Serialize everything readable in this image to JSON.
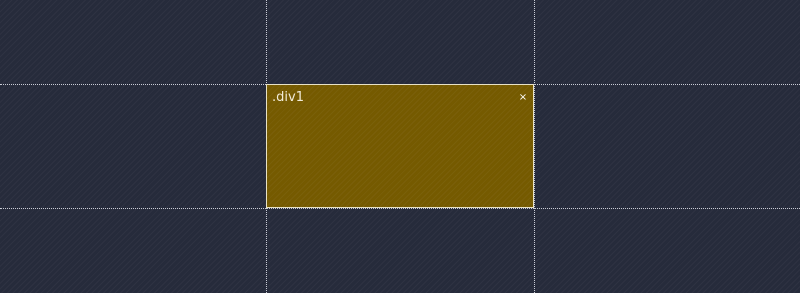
{
  "element": {
    "label": ".div1",
    "close_glyph": "×",
    "close_icon": "close-icon",
    "fill_color": "#755a00"
  },
  "canvas": {
    "background_color": "#262b3b",
    "guide_color": "#c9ccd6"
  }
}
